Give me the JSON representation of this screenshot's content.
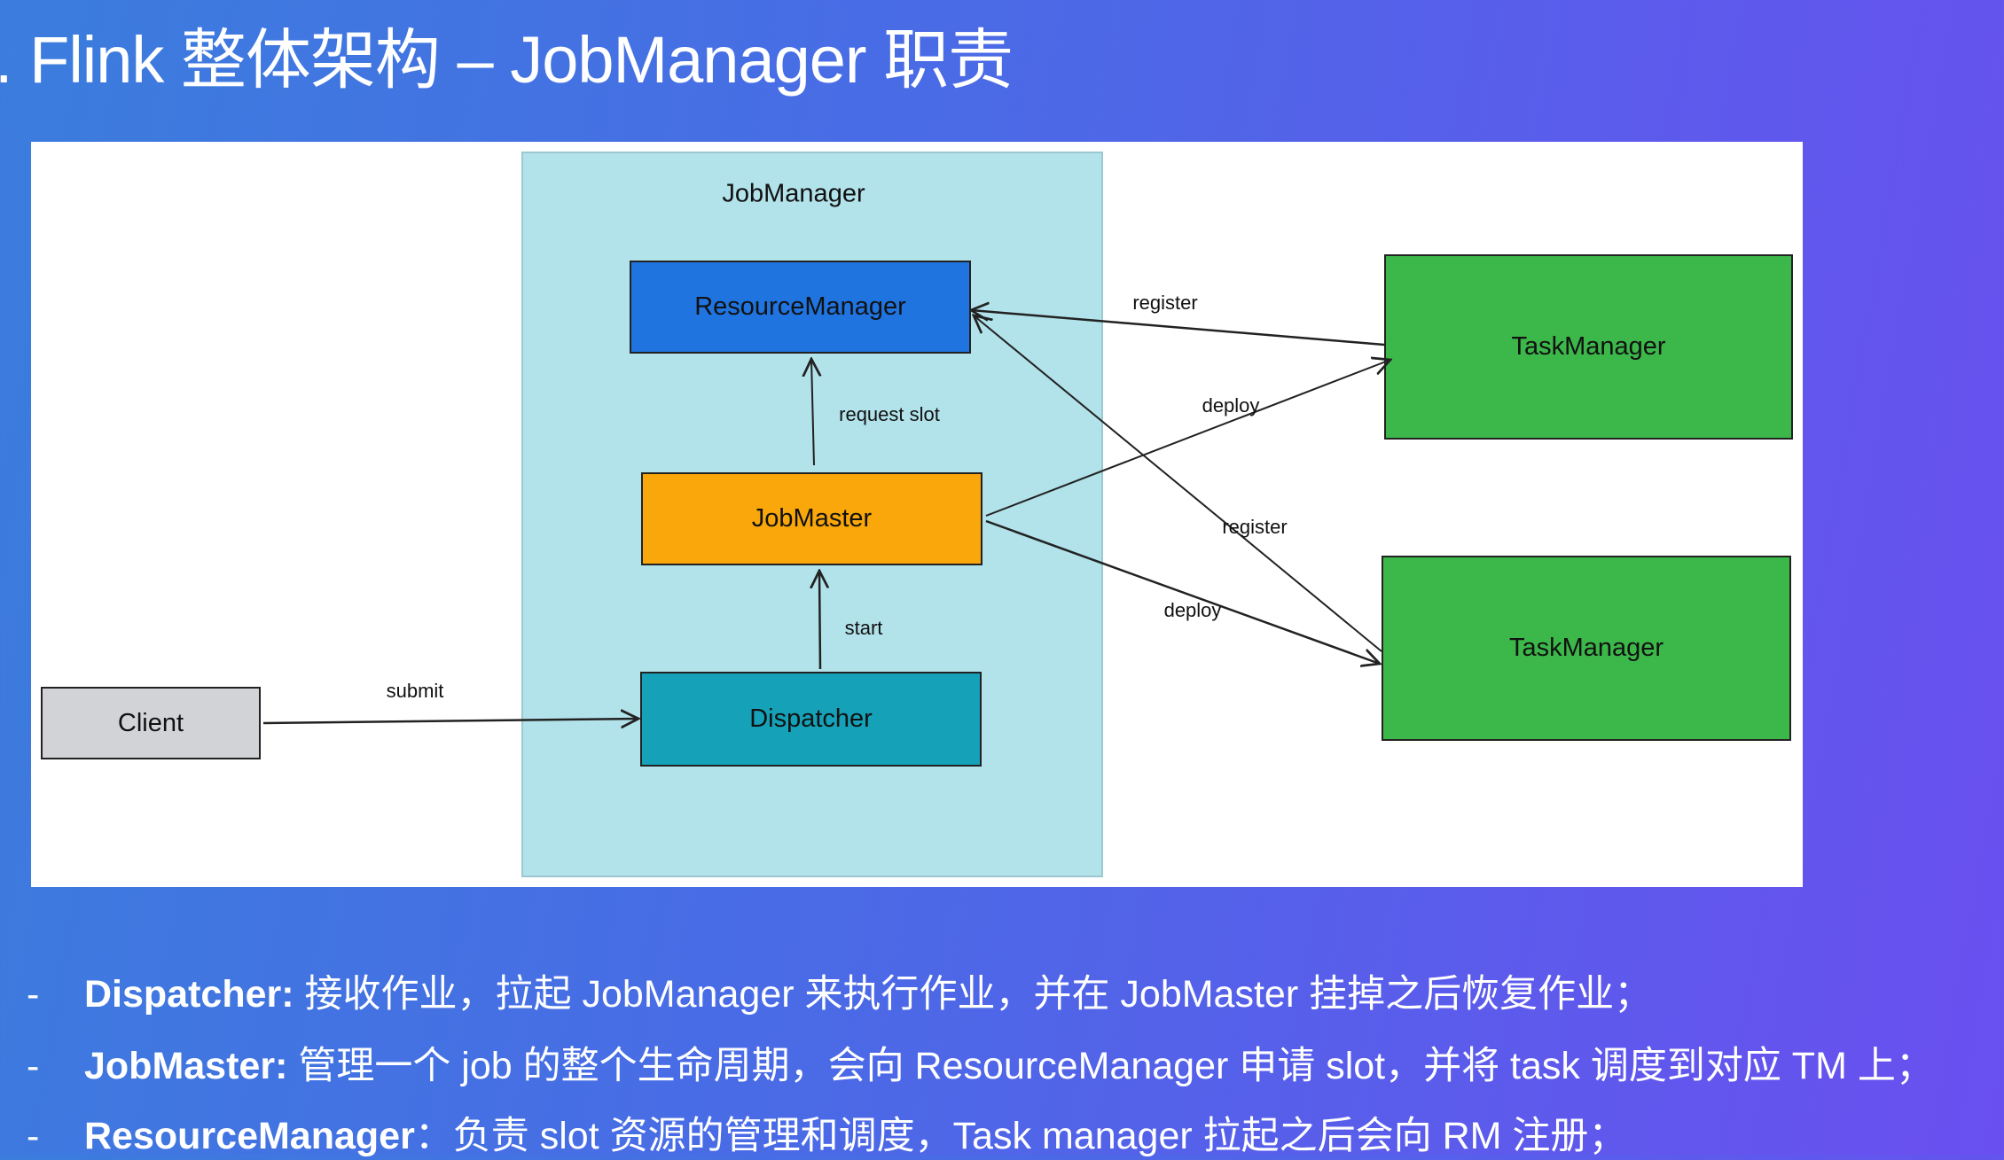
{
  "title": ". Flink 整体架构 – JobManager 职责",
  "diagram": {
    "container": {
      "label": "JobManager",
      "color": "#b2e2ea"
    },
    "nodes": {
      "resource_manager": {
        "label": "ResourceManager",
        "color": "#1f74e0"
      },
      "job_master": {
        "label": "JobMaster",
        "color": "#f9a70a"
      },
      "dispatcher": {
        "label": "Dispatcher",
        "color": "#15a2b9"
      },
      "client": {
        "label": "Client",
        "color": "#d1d3d7"
      },
      "task_manager_1": {
        "label": "TaskManager",
        "color": "#3cb84a"
      },
      "task_manager_2": {
        "label": "TaskManager",
        "color": "#3cb84a"
      }
    },
    "edges": [
      {
        "from": "task_manager_1",
        "to": "resource_manager",
        "label": "register"
      },
      {
        "from": "job_master",
        "to": "task_manager_1",
        "label": "deploy"
      },
      {
        "from": "task_manager_2",
        "to": "resource_manager",
        "label": "register"
      },
      {
        "from": "job_master",
        "to": "task_manager_2",
        "label": "deploy"
      },
      {
        "from": "job_master",
        "to": "resource_manager",
        "label": "request slot"
      },
      {
        "from": "dispatcher",
        "to": "job_master",
        "label": "start"
      },
      {
        "from": "client",
        "to": "dispatcher",
        "label": "submit"
      }
    ]
  },
  "bullets": [
    {
      "dash": "-",
      "term": "Dispatcher:",
      "text": " 接收作业，拉起 JobManager 来执行作业，并在 JobMaster 挂掉之后恢复作业；"
    },
    {
      "dash": "-",
      "term": "JobMaster:",
      "text": " 管理一个 job 的整个生命周期，会向 ResourceManager 申请 slot，并将 task 调度到对应 TM 上；"
    },
    {
      "dash": "-",
      "term": "ResourceManager",
      "text": "：负责 slot 资源的管理和调度，Task manager 拉起之后会向 RM 注册；"
    }
  ]
}
